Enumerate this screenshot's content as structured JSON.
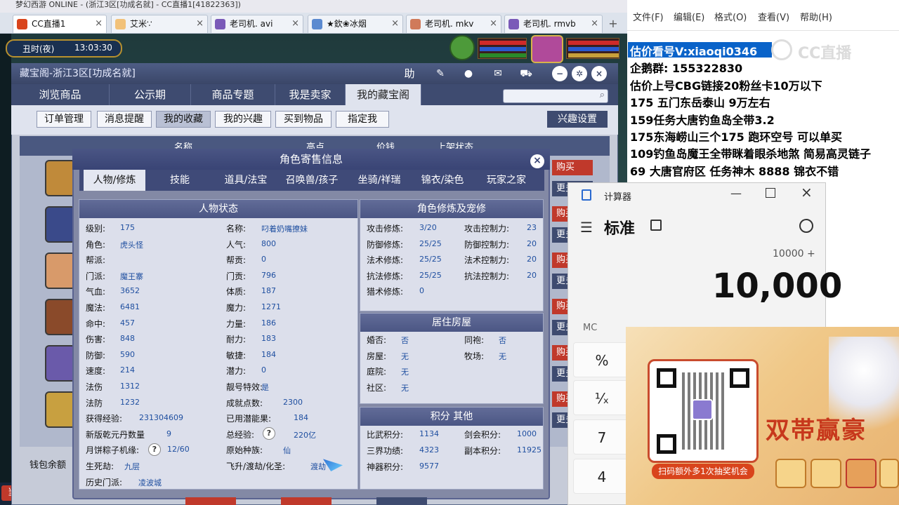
{
  "browser": {
    "title": "梦幻西游 ONLINE - (浙江3区[功成名就] - CC直播1[41822363])",
    "tabs": [
      {
        "label": "CC直播1"
      },
      {
        "label": "艾米∵"
      },
      {
        "label": "老司机. avi"
      },
      {
        "label": "★欽❀冰烟"
      },
      {
        "label": "老司机. mkv"
      },
      {
        "label": "老司机. rmvb"
      }
    ]
  },
  "game": {
    "time": "丑时(夜)",
    "clock": "13:03:30",
    "chat_tab": "当前"
  },
  "cbg": {
    "title": "藏宝阁-浙江3区[功成名就]",
    "button_help": "助",
    "nav": [
      "浏览商品",
      "公示期",
      "商品专题",
      "我是卖家",
      "我的藏宝阁"
    ],
    "sub": [
      "订单管理",
      "消息提醒",
      "我的收藏",
      "我的兴趣",
      "买到物品",
      "指定我"
    ],
    "interest_settings": "兴趣设置",
    "list_headers": [
      "名称",
      "高点",
      "价钱",
      "上架状态"
    ],
    "buy_label": "购买",
    "more_label": "更多",
    "wallet": "钱包余额"
  },
  "dialog": {
    "title": "角色寄售信息",
    "tabs": [
      "人物/修炼",
      "技能",
      "道具/法宝",
      "召唤兽/孩子",
      "坐骑/祥瑞",
      "锦衣/染色",
      "玩家之家"
    ],
    "status_title": "人物状态",
    "left": [
      {
        "k": "级别:",
        "v": "175"
      },
      {
        "k": "角色:",
        "v": "虎头怪"
      },
      {
        "k": "帮派:",
        "v": ""
      },
      {
        "k": "门派:",
        "v": "魔王寨"
      },
      {
        "k": "气血:",
        "v": "3652"
      },
      {
        "k": "魔法:",
        "v": "6481"
      },
      {
        "k": "命中:",
        "v": "457"
      },
      {
        "k": "伤害:",
        "v": "848"
      },
      {
        "k": "防御:",
        "v": "590"
      },
      {
        "k": "速度:",
        "v": "214"
      },
      {
        "k": "法伤",
        "v": "1312"
      },
      {
        "k": "法防",
        "v": "1232"
      },
      {
        "k": "获得经验:",
        "v": "231304609"
      },
      {
        "k": "新版乾元丹数量",
        "v": "9"
      },
      {
        "k": "月饼粽子机缘:",
        "v": "12/60"
      },
      {
        "k": "生死劫:",
        "v": "九层"
      },
      {
        "k": "历史门派:",
        "v": "凌波城"
      }
    ],
    "mid": [
      {
        "k": "名称:",
        "v": "叼着奶嘴撩妹"
      },
      {
        "k": "人气:",
        "v": "800"
      },
      {
        "k": "帮贡:",
        "v": "0"
      },
      {
        "k": "门贡:",
        "v": "796"
      },
      {
        "k": "体质:",
        "v": "187"
      },
      {
        "k": "魔力:",
        "v": "1271"
      },
      {
        "k": "力量:",
        "v": "186"
      },
      {
        "k": "耐力:",
        "v": "183"
      },
      {
        "k": "敏捷:",
        "v": "184"
      },
      {
        "k": "潜力:",
        "v": "0"
      },
      {
        "k": "靓号特效:",
        "v": "是"
      },
      {
        "k": "成就点数:",
        "v": "2300"
      },
      {
        "k": "已用潜能果:",
        "v": "184"
      },
      {
        "k": "总经验:",
        "v": "220亿"
      },
      {
        "k": "原始种族:",
        "v": "仙"
      },
      {
        "k": "飞升/渡劫/化圣:",
        "v": "渡劫"
      }
    ],
    "cultivation_title": "角色修炼及宠修",
    "cultivation_l": [
      {
        "k": "攻击修炼:",
        "v": "3/20"
      },
      {
        "k": "防御修炼:",
        "v": "25/25"
      },
      {
        "k": "法术修炼:",
        "v": "25/25"
      },
      {
        "k": "抗法修炼:",
        "v": "25/25"
      },
      {
        "k": "猎术修炼:",
        "v": "0"
      }
    ],
    "cultivation_r": [
      {
        "k": "攻击控制力:",
        "v": "23"
      },
      {
        "k": "防御控制力:",
        "v": "20"
      },
      {
        "k": "法术控制力:",
        "v": "20"
      },
      {
        "k": "抗法控制力:",
        "v": "20"
      }
    ],
    "house_title": "居住房屋",
    "house_l": [
      {
        "k": "婚否:",
        "v": "否"
      },
      {
        "k": "房屋:",
        "v": "无"
      },
      {
        "k": "庭院:",
        "v": "无"
      },
      {
        "k": "社区:",
        "v": "无"
      }
    ],
    "house_r": [
      {
        "k": "同袍:",
        "v": "否"
      },
      {
        "k": "牧场:",
        "v": "无"
      }
    ],
    "score_title": "积分 其他",
    "score_l": [
      {
        "k": "比武积分:",
        "v": "1134"
      },
      {
        "k": "三界功绩:",
        "v": "4323"
      },
      {
        "k": "神器积分:",
        "v": "9577"
      }
    ],
    "score_r": [
      {
        "k": "剑会积分:",
        "v": "1000"
      },
      {
        "k": "副本积分:",
        "v": "11925"
      }
    ]
  },
  "notepad": {
    "menu": [
      "文件(F)",
      "编辑(E)",
      "格式(O)",
      "查看(V)",
      "帮助(H)"
    ],
    "lines": [
      "估价看号V:xiaoqi0346",
      "企鹅群:  155322830",
      "估价上号CBG链接20粉丝卡10万以下",
      "175 五门东岳泰山  9万左右",
      "159任务大唐钓鱼岛全带3.2",
      "175东海崂山三个175 跑环空号 可以单买",
      "109钓鱼岛魔王全带眯着眼杀地煞 简易高灵链子",
      "69  大唐官府区 任务神木 8888 锦衣不错"
    ],
    "watermark": "CC直播"
  },
  "calculator": {
    "title": "计算器",
    "mode": "标准",
    "expression": "10000 +",
    "display": "10,000",
    "memory": "MC",
    "keys": [
      "%",
      "¹⁄ₓ",
      "7",
      "4"
    ]
  },
  "promo": {
    "slogan": "双帯赢豪",
    "caption": "扫码额外多1次抽奖机会",
    "accent": "#d9441c"
  }
}
